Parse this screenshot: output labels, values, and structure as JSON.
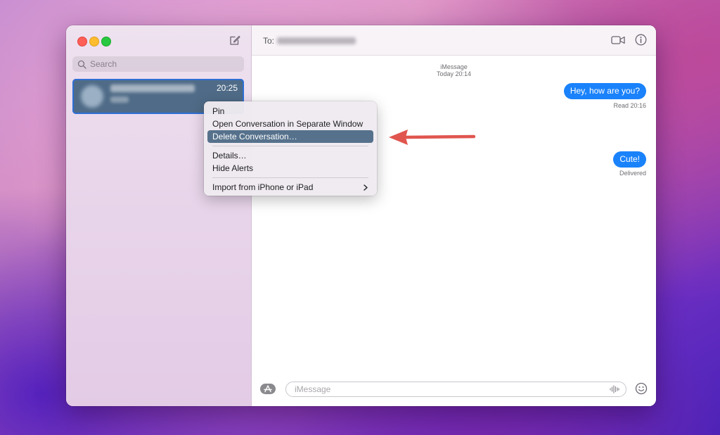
{
  "sidebar": {
    "search_placeholder": "Search",
    "conversation": {
      "time": "20:25"
    }
  },
  "header": {
    "to_label": "To:"
  },
  "thread": {
    "service": "iMessage",
    "service_time": "Today 20:14",
    "messages": [
      {
        "text": "Hey, how are you?",
        "receipt": "Read 20:16"
      },
      {
        "text": "Cute!",
        "receipt": "Delivered"
      }
    ]
  },
  "composer": {
    "placeholder": "iMessage"
  },
  "context_menu": {
    "items": [
      {
        "label": "Pin"
      },
      {
        "label": "Open Conversation in Separate Window"
      },
      {
        "label": "Delete Conversation…"
      },
      {
        "label": "Details…"
      },
      {
        "label": "Hide Alerts"
      },
      {
        "label": "Import from iPhone or iPad"
      }
    ],
    "highlighted": "Delete Conversation…"
  },
  "colors": {
    "accent_bubble": "#1a82fb",
    "menu_highlight": "#56718c",
    "annotation_arrow": "#e0564f"
  }
}
